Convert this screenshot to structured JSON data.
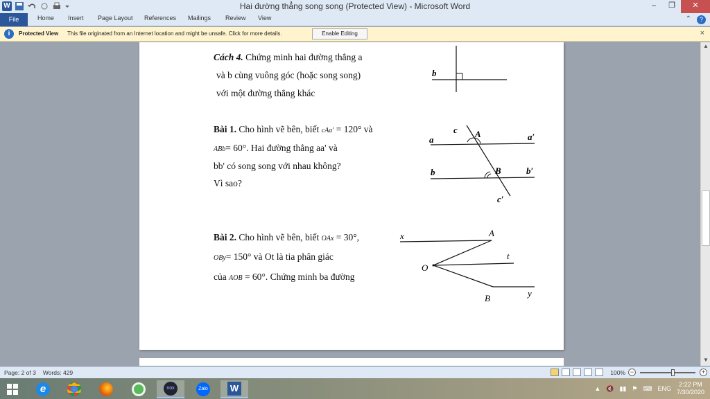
{
  "window": {
    "title": "Hai đường thẳng song song (Protected View)  -  Microsoft Word",
    "app_icon": "W"
  },
  "ribbon": {
    "tabs": [
      "File",
      "Home",
      "Insert",
      "Page Layout",
      "References",
      "Mailings",
      "Review",
      "View"
    ]
  },
  "protected_view": {
    "title": "Protected View",
    "message": "This file originated from an Internet location and might be unsafe. Click for more details.",
    "button": "Enable Editing",
    "close": "×"
  },
  "document": {
    "cach4": {
      "label": "Cách 4.",
      "line1": " Chứng minh hai đường thẳng a",
      "line2": "và b cùng vuông góc (hoặc song song)",
      "line3": "với một đường thẳng khác"
    },
    "fig1": {
      "b": "b"
    },
    "bai1": {
      "label": "Bài 1.",
      "line1a": " Cho hình vẽ bên, biết ",
      "angle1": "cAa′",
      "line1b": " = 120° và",
      "angle2": "ABb",
      "line2b": "= 60°. Hai đường thẳng aa' và",
      "line3": "bb' có song song với nhau không?",
      "line4": "Vì sao?"
    },
    "fig2": {
      "a": "a",
      "a2": "a′",
      "b": "b",
      "b2": "b′",
      "c": "c",
      "c2": "c′",
      "A": "A",
      "B": "B"
    },
    "bai2": {
      "label": "Bài 2.",
      "line1a": " Cho hình vẽ bên, biết ",
      "angle1": "OAx",
      "line1b": " = 30°,",
      "angle2": "OBy",
      "line2b": "= 150° và Ot là tia phân giác",
      "line3a": "của ",
      "angle3": "AOB",
      "line3b": " = 60°. Chứng minh ba đường"
    },
    "fig3": {
      "x": "x",
      "A": "A",
      "t": "t",
      "O": "O",
      "B": "B",
      "y": "y"
    }
  },
  "status": {
    "page": "Page: 2 of 3",
    "words": "Words: 429",
    "zoom": "100%"
  },
  "taskbar": {
    "lang": "ENG",
    "time": "2:22 PM",
    "date": "7/30/2020",
    "apps": [
      "windows-start",
      "internet-explorer",
      "chrome",
      "firefox",
      "app-green",
      "nox",
      "zalo",
      "word"
    ]
  }
}
